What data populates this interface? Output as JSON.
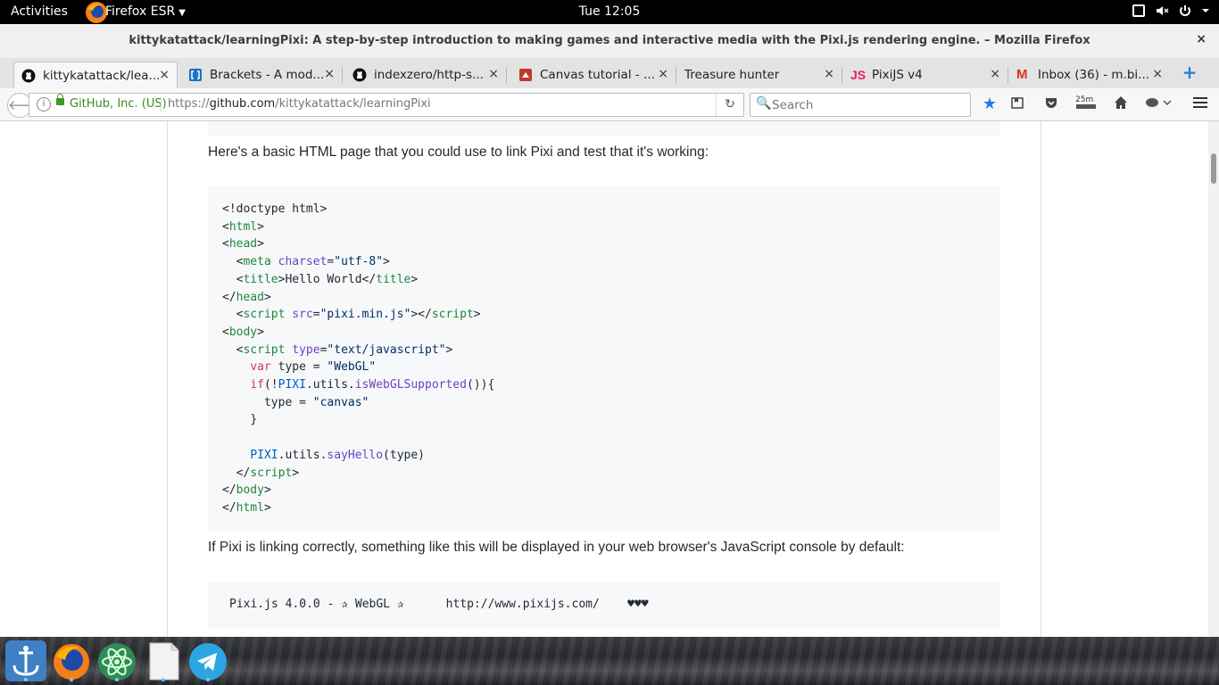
{
  "topbar": {
    "activities": "Activities",
    "app_name": "Firefox ESR",
    "clock": "Tue 12:05"
  },
  "window": {
    "title": "kittykatattack/learningPixi: A step-by-step introduction to making games and interactive media with the Pixi.js rendering engine. – Mozilla Firefox",
    "close": "×"
  },
  "tabs": [
    {
      "label": "kittykatattack/lea...",
      "close": "×"
    },
    {
      "label": "Brackets - A mod...",
      "close": "×"
    },
    {
      "label": "indexzero/http-s...",
      "close": "×"
    },
    {
      "label": "Canvas tutorial - ...",
      "close": "×"
    },
    {
      "label": "Treasure hunter",
      "close": "×"
    },
    {
      "label": "PixiJS v4",
      "close": "×"
    },
    {
      "label": "Inbox (36) - m.bi...",
      "close": "×"
    }
  ],
  "newtab": "+",
  "nav": {
    "identity": "GitHub, Inc. (US)",
    "url_prefix": "https://",
    "url_domain": "github.com",
    "url_path": "/kittykatattack/learningPixi",
    "search_placeholder": "Search",
    "timer_badge": "25m"
  },
  "page": {
    "intro": "Here's a basic HTML page that you could use to link Pixi and test that it's working:",
    "after_code": "If Pixi is linking correctly, something like this will be displayed in your web browser's JavaScript console by default:",
    "console_output": "Pixi.js 4.0.0 - ✰ WebGL ✰      http://www.pixijs.com/    ♥♥♥"
  },
  "code": {
    "l1": "<!doctype html>",
    "lt": "<",
    "gt": ">",
    "lt_slash": "</",
    "html": "html",
    "head": "head",
    "meta": "meta",
    "charset_attr": "charset",
    "charset_val": "\"utf-8\"",
    "title": "title",
    "title_text": "Hello World",
    "script": "script",
    "src_attr": "src",
    "src_val": "\"pixi.min.js\"",
    "body": "body",
    "type_attr": "type",
    "type_val": "\"text/javascript\"",
    "var": "var",
    "type_var": " type = ",
    "webgl": "\"WebGL\"",
    "if": "if",
    "not": "(!",
    "pixi": "PIXI",
    "utils": ".utils.",
    "isWebGL": "isWebGLSupported",
    "if_tail": "()){",
    "type_assign": "type = ",
    "canvas": "\"canvas\"",
    "close_brace": "}",
    "sayHello": "sayHello",
    "say_args": "(type)",
    "eq": "="
  },
  "colors": {
    "code_bg": "#f6f8fa",
    "tag": "#22863a",
    "attr": "#6f42c1",
    "string": "#032f62",
    "keyword": "#d73a49",
    "constant": "#005cc5"
  }
}
